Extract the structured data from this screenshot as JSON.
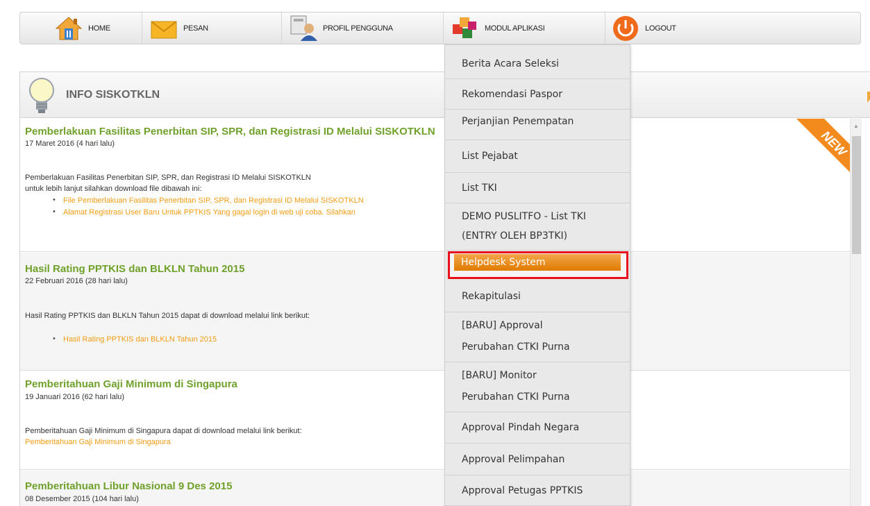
{
  "nav": {
    "home": "HOME",
    "messages": "PESAN",
    "profile": "PROFIL PENGGUNA",
    "modules": "MODUL APLIKASI",
    "logout": "LOGOUT"
  },
  "info": {
    "title": "INFO SISKOTKLN",
    "news": [
      {
        "title": "Pemberlakuan Fasilitas Penerbitan SIP, SPR, dan Registrasi ID Melalui SISKOTKLN",
        "date": "17 Maret 2016 (4 hari lalu)",
        "body1": "Pemberlakuan Fasilitas Penerbitan SIP, SPR, dan Registrasi ID Melalui SISKOTKLN",
        "body2": "untuk lebih lanjut silahkan download file dibawah ini:",
        "links": [
          "File Pemberlakuan Fasilitas Penerbitan SIP, SPR, dan Registrasi ID Melalui SISKOTKLN",
          "Alamat Registrasi User Baru Untuk PPTKIS Yang gagal login di web uji coba. Silahkan"
        ]
      },
      {
        "title": "Hasil Rating PPTKIS dan BLKLN Tahun 2015",
        "date": "22 Februari 2016 (28 hari lalu)",
        "body1": "Hasil Rating PPTKIS dan BLKLN Tahun 2015 dapat di download melalui link berikut:",
        "links": [
          "Hasil Rating PPTKIS dan BLKLN Tahun 2015"
        ]
      },
      {
        "title": "Pemberitahuan Gaji Minimum di Singapura",
        "date": "19 Januari 2016 (62 hari lalu)",
        "body1": "Pemberitahuan Gaji Minimum di Singapura dapat di download melalui link berikut:",
        "links": [
          "Pemberitahuan Gaji Minimum di Singapura"
        ]
      },
      {
        "title": "Pemberitahuan Libur Nasional 9 Des 2015",
        "date": "08 Desember 2015 (104 hari lalu)"
      }
    ],
    "ribbon": "NEW"
  },
  "dropdown": {
    "items": [
      "Berita Acara Seleksi",
      "Rekomendasi Paspor",
      "Perjanjian Penempatan",
      "List Pejabat",
      "List TKI",
      "DEMO PUSLITFO - List TKI",
      "(ENTRY OLEH BP3TKI)",
      "Helpdesk System",
      "Rekapitulasi",
      "[BARU] Approval",
      "Perubahan CTKI Purna",
      "[BARU] Monitor",
      "Perubahan CTKI Purna",
      "Approval Pindah Negara",
      "Approval Pelimpahan",
      "Approval Petugas PPTKIS"
    ]
  },
  "colors": {
    "news_title": "#6fa12b",
    "link": "#f39c12",
    "highlight": "#e07b00",
    "selection_border": "#e8101c"
  }
}
